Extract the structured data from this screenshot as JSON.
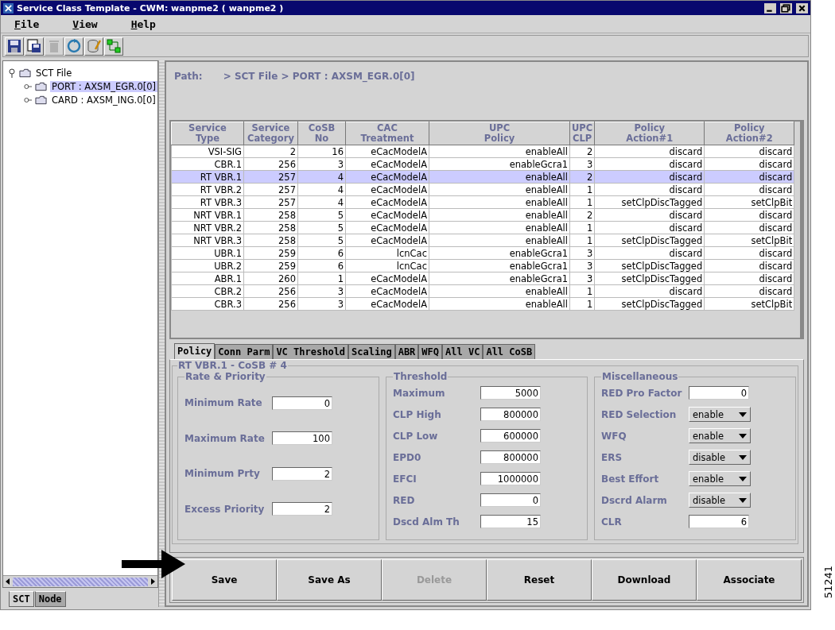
{
  "window": {
    "title": "Service Class Template - CWM: wanpme2 ( wanpme2 )"
  },
  "menu": [
    "File",
    "View",
    "Help"
  ],
  "toolbar": [
    {
      "kind": "save",
      "disabled": false
    },
    {
      "kind": "save-as",
      "disabled": false
    },
    {
      "kind": "delete",
      "disabled": true
    },
    {
      "kind": "refresh",
      "disabled": false
    },
    {
      "kind": "edit-db",
      "disabled": false
    },
    {
      "kind": "connect",
      "disabled": false
    }
  ],
  "tree": {
    "label": "SCT File",
    "expanded": true,
    "selected": false,
    "children": [
      {
        "label": "PORT : AXSM_EGR.0[0]",
        "selected": true
      },
      {
        "label": "CARD : AXSM_ING.0[0]",
        "selected": false
      }
    ]
  },
  "left_tabs": [
    {
      "label": "SCT",
      "selected": true
    },
    {
      "label": "Node",
      "selected": false
    }
  ],
  "path": {
    "label": "Path:",
    "value": "> SCT File > PORT : AXSM_EGR.0[0]"
  },
  "table": {
    "columns": [
      "Service Type",
      "Service Category",
      "CoSB No",
      "CAC Treatment",
      "UPC Policy",
      "UPC CLP",
      "Policy Action#1",
      "Policy Action#2"
    ],
    "rows": [
      {
        "cells": [
          "VSI-SIG",
          "2",
          "16",
          "eCacModelA",
          "enableAll",
          "2",
          "discard",
          "discard"
        ],
        "selected": false
      },
      {
        "cells": [
          "CBR.1",
          "256",
          "3",
          "eCacModelA",
          "enableGcra1",
          "3",
          "discard",
          "discard"
        ],
        "selected": false
      },
      {
        "cells": [
          "RT VBR.1",
          "257",
          "4",
          "eCacModelA",
          "enableAll",
          "2",
          "discard",
          "discard"
        ],
        "selected": true
      },
      {
        "cells": [
          "RT VBR.2",
          "257",
          "4",
          "eCacModelA",
          "enableAll",
          "1",
          "discard",
          "discard"
        ],
        "selected": false
      },
      {
        "cells": [
          "RT VBR.3",
          "257",
          "4",
          "eCacModelA",
          "enableAll",
          "1",
          "setClpDiscTagged",
          "setClpBit"
        ],
        "selected": false
      },
      {
        "cells": [
          "NRT VBR.1",
          "258",
          "5",
          "eCacModelA",
          "enableAll",
          "2",
          "discard",
          "discard"
        ],
        "selected": false
      },
      {
        "cells": [
          "NRT VBR.2",
          "258",
          "5",
          "eCacModelA",
          "enableAll",
          "1",
          "discard",
          "discard"
        ],
        "selected": false
      },
      {
        "cells": [
          "NRT VBR.3",
          "258",
          "5",
          "eCacModelA",
          "enableAll",
          "1",
          "setClpDiscTagged",
          "setClpBit"
        ],
        "selected": false
      },
      {
        "cells": [
          "UBR.1",
          "259",
          "6",
          "lcnCac",
          "enableGcra1",
          "3",
          "discard",
          "discard"
        ],
        "selected": false
      },
      {
        "cells": [
          "UBR.2",
          "259",
          "6",
          "lcnCac",
          "enableGcra1",
          "3",
          "setClpDiscTagged",
          "discard"
        ],
        "selected": false
      },
      {
        "cells": [
          "ABR.1",
          "260",
          "1",
          "eCacModelA",
          "enableGcra1",
          "3",
          "setClpDiscTagged",
          "discard"
        ],
        "selected": false
      },
      {
        "cells": [
          "CBR.2",
          "256",
          "3",
          "eCacModelA",
          "enableAll",
          "1",
          "discard",
          "discard"
        ],
        "selected": false
      },
      {
        "cells": [
          "CBR.3",
          "256",
          "3",
          "eCacModelA",
          "enableAll",
          "1",
          "setClpDiscTagged",
          "setClpBit"
        ],
        "selected": false
      }
    ]
  },
  "tabs": [
    {
      "label": "Policy",
      "selected": true
    },
    {
      "label": "Conn Parm",
      "selected": false
    },
    {
      "label": "VC Threshold",
      "selected": false
    },
    {
      "label": "Scaling",
      "selected": false
    },
    {
      "label": "ABR",
      "selected": false
    },
    {
      "label": "WFQ",
      "selected": false
    },
    {
      "label": "All VC",
      "selected": false
    },
    {
      "label": "All CoSB",
      "selected": false
    }
  ],
  "policy": {
    "title": "RT VBR.1 - CoSB # 4",
    "groups": [
      {
        "title": "Rate & Priority",
        "spread": true,
        "fields": [
          {
            "label": "Minimum Rate",
            "kind": "input",
            "value": "0"
          },
          {
            "label": "Maximum Rate",
            "kind": "input",
            "value": "100"
          },
          {
            "label": "Minimum Prty",
            "kind": "input",
            "value": "2"
          },
          {
            "label": "Excess Priority",
            "kind": "input",
            "value": "2"
          }
        ]
      },
      {
        "title": "Threshold",
        "spread": false,
        "fields": [
          {
            "label": "Maximum",
            "kind": "input",
            "value": "5000"
          },
          {
            "label": "CLP High",
            "kind": "input",
            "value": "800000"
          },
          {
            "label": "CLP Low",
            "kind": "input",
            "value": "600000"
          },
          {
            "label": "EPD0",
            "kind": "input",
            "value": "800000"
          },
          {
            "label": "EFCI",
            "kind": "input",
            "value": "1000000"
          },
          {
            "label": "RED",
            "kind": "input",
            "value": "0"
          },
          {
            "label": "Dscd Alm Th",
            "kind": "input",
            "value": "15"
          }
        ]
      },
      {
        "title": "Miscellaneous",
        "spread": false,
        "fields": [
          {
            "label": "RED Pro Factor",
            "kind": "input",
            "value": "0"
          },
          {
            "label": "RED Selection",
            "kind": "select",
            "value": "enable"
          },
          {
            "label": "WFQ",
            "kind": "select",
            "value": "enable"
          },
          {
            "label": "ERS",
            "kind": "select",
            "value": "disable"
          },
          {
            "label": "Best Effort",
            "kind": "select",
            "value": "enable"
          },
          {
            "label": "Dscrd Alarm",
            "kind": "select",
            "value": "disable"
          },
          {
            "label": "CLR",
            "kind": "input",
            "value": "6"
          }
        ]
      }
    ]
  },
  "buttons": [
    {
      "label": "Save",
      "disabled": false
    },
    {
      "label": "Save As",
      "disabled": false
    },
    {
      "label": "Delete",
      "disabled": true
    },
    {
      "label": "Reset",
      "disabled": false
    },
    {
      "label": "Download",
      "disabled": false
    },
    {
      "label": "Associate",
      "disabled": false
    }
  ],
  "figure_number": "51241"
}
